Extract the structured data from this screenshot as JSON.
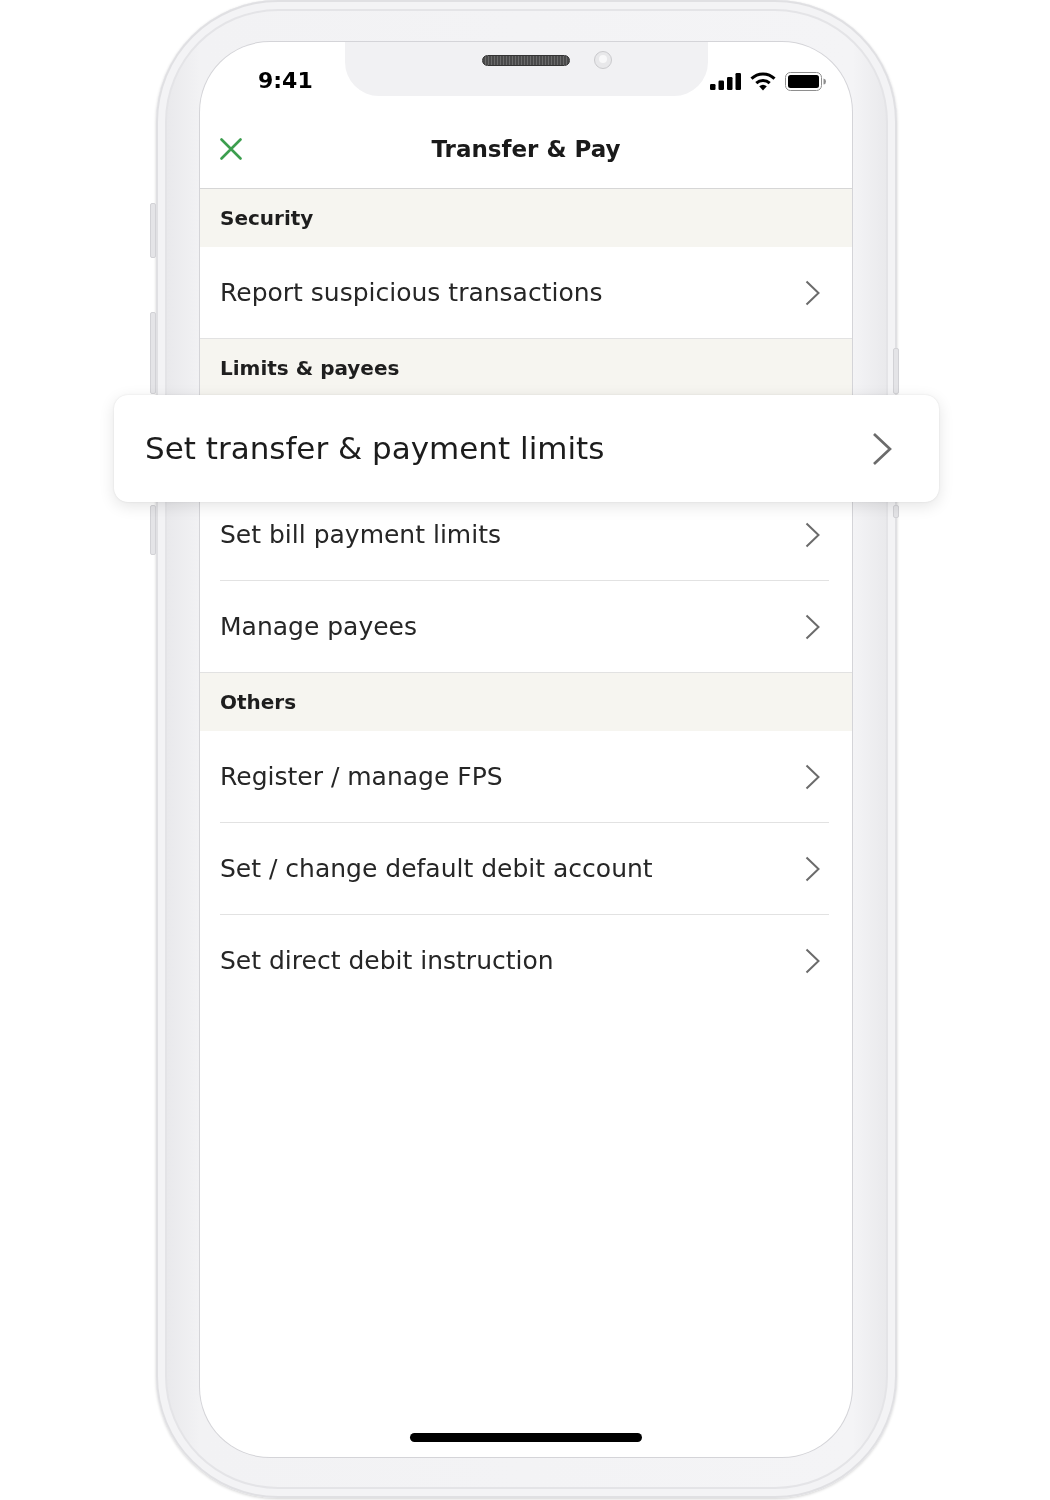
{
  "status_bar": {
    "time": "9:41"
  },
  "header": {
    "title": "Transfer & Pay"
  },
  "sections": [
    {
      "title": "Security",
      "items": [
        {
          "label": "Report suspicious transactions",
          "highlighted": false
        }
      ]
    },
    {
      "title": "Limits & payees",
      "items": [
        {
          "label": "Set transfer & payment limits",
          "highlighted": true
        },
        {
          "label": "Set bill payment limits",
          "highlighted": false
        },
        {
          "label": "Manage payees",
          "highlighted": false
        }
      ]
    },
    {
      "title": "Others",
      "items": [
        {
          "label": "Register / manage FPS",
          "highlighted": false
        },
        {
          "label": "Set / change default debit account",
          "highlighted": false
        },
        {
          "label": "Set direct debit instruction",
          "highlighted": false
        }
      ]
    }
  ]
}
